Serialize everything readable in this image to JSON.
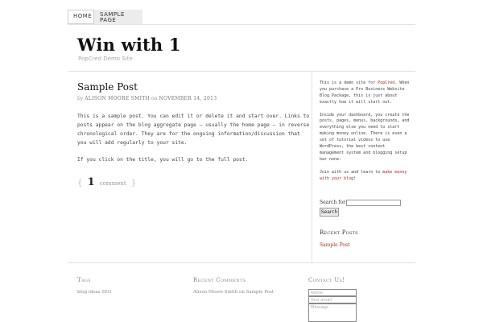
{
  "nav": {
    "home": "Home",
    "sample_page": "Sample Page"
  },
  "site": {
    "title": "Win with 1",
    "description": "PopCred Demo Site"
  },
  "post": {
    "title": "Sample Post",
    "meta_by": "by",
    "meta_author": "Alison Moore Smith",
    "meta_on": "on",
    "meta_date": "November 14, 2013",
    "paragraph1": "This is a sample post. You can edit it or delete it and start over. Links to posts appear on the blog aggregate page — usually the home page — in reverse chronological order. They are for the ongoing information/discussion that you will add regularly to your site.",
    "paragraph2": "If you click on the title, you will go to the full post.",
    "comment_open": "{",
    "comment_count": "1",
    "comment_word": "comment",
    "comment_close": "}"
  },
  "sidebar": {
    "text1_a": "This is a demo site for ",
    "text1_link": "PopCred",
    "text1_b": ". When you purchase a Pro Business Website Blog Package, this is just about exactly how it will start out.",
    "text2": "Inside your dashboard, you create the posts, pages, menus, backgrounds, and everything else you need to start making money online. There is even a set of tutorial videos to use WordPress, the best content management system and blogging setup bar none.",
    "text3_a": "Join with us and learn to ",
    "text3_link": "make money with your blog",
    "text3_b": "!",
    "search_label": "Search for:",
    "search_button": "Search",
    "recent_posts_title": "Recent Posts",
    "recent_post_1": "Sample Post"
  },
  "footer": {
    "tags_title": "Tags",
    "tags_text": "blog ideas SEO",
    "recent_comments_title": "Recent Comments",
    "recent_comment_author": "Alison Moore Smith",
    "recent_comment_on": "on",
    "recent_comment_post": "Sample Post",
    "contact_title": "Contact Us!",
    "name_placeholder": "Name",
    "email_placeholder": "Your email",
    "message_placeholder": "Message"
  }
}
